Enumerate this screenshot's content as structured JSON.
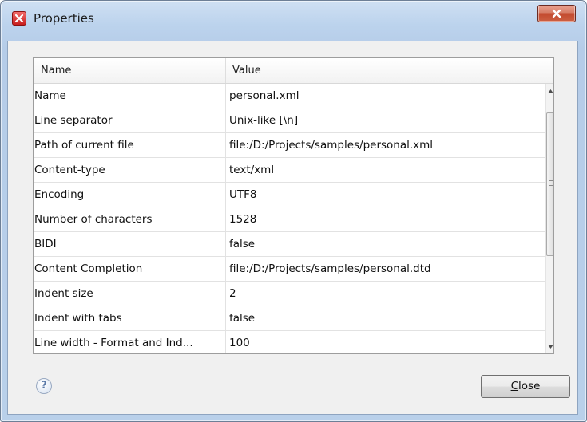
{
  "window": {
    "title": "Properties",
    "app_icon": "oxygen-x-icon",
    "close_glyph": "X"
  },
  "table": {
    "columns": [
      "Name",
      "Value"
    ],
    "rows": [
      {
        "name": "Name",
        "value": "personal.xml"
      },
      {
        "name": "Line separator",
        "value": "Unix-like [\\n]"
      },
      {
        "name": "Path of current file",
        "value": "file:/D:/Projects/samples/personal.xml"
      },
      {
        "name": "Content-type",
        "value": "text/xml"
      },
      {
        "name": "Encoding",
        "value": "UTF8"
      },
      {
        "name": "Number of characters",
        "value": "1528"
      },
      {
        "name": "BIDI",
        "value": "false"
      },
      {
        "name": "Content Completion",
        "value": "file:/D:/Projects/samples/personal.dtd"
      },
      {
        "name": "Indent size",
        "value": "2"
      },
      {
        "name": "Indent with tabs",
        "value": "false"
      },
      {
        "name": "Line width - Format and Ind...",
        "value": "100"
      }
    ]
  },
  "footer": {
    "help_glyph": "?",
    "close_label_first": "C",
    "close_label_rest": "lose"
  },
  "colors": {
    "title_bar": "#bcd3ed",
    "close_red": "#c34a2e",
    "client_bg": "#f0f0f0"
  }
}
